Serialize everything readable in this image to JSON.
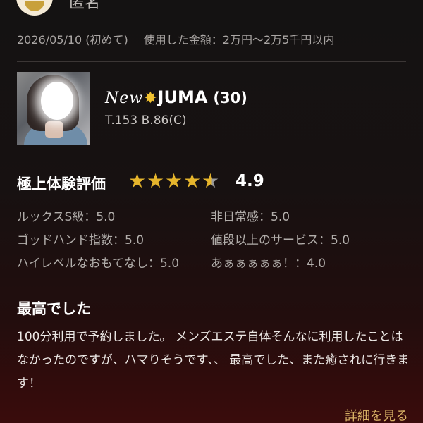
{
  "reviewer": {
    "name": "匿名"
  },
  "meta": {
    "date": "2026/05/10 (初めて)",
    "amount": "使用した金額：2万円〜2万5千円以内"
  },
  "cast": {
    "new_badge": "New",
    "name": "JUMA",
    "age": "(30)",
    "stats": "T.153 B.86(C)"
  },
  "rating": {
    "title": "極上体験評価",
    "score": "4.9",
    "score_value": 4.9,
    "star_color": "#e6b52c",
    "items": [
      {
        "label": "ルックスS級：5.0"
      },
      {
        "label": "非日常感：5.0"
      },
      {
        "label": "ゴッドハンド指数：5.0"
      },
      {
        "label": "値段以上のサービス：5.0"
      },
      {
        "label": "ハイレベルなおもてなし：5.0"
      },
      {
        "label": "あぁぁぁぁぁ！：4.0"
      }
    ]
  },
  "review": {
    "title": "最高でした",
    "body": "100分利用で予約しました。 メンズエステ自体そんなに利用したことはなかったのですが、ハマりそうです、、 最高でした、また癒されに行きます！"
  },
  "more_link": "詳細を見る"
}
